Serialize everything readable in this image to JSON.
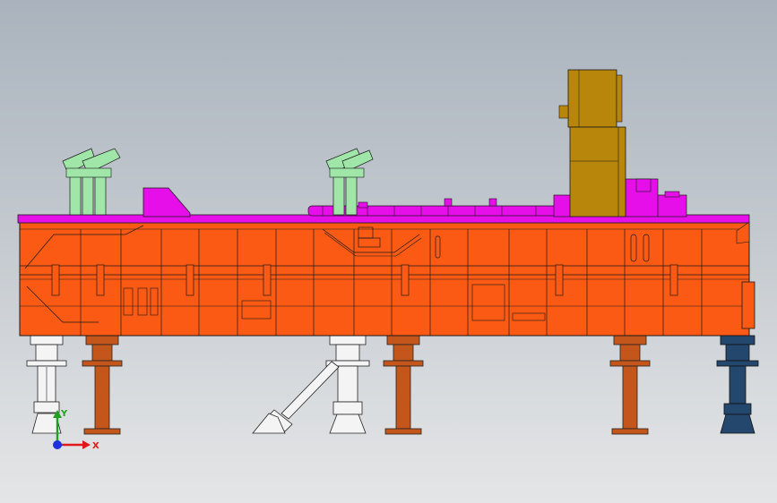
{
  "viewport": {
    "background_top": "#aab3bd",
    "background_bottom": "#e4e5e6"
  },
  "model": {
    "colors": {
      "base_frame": "#fb5a14",
      "top_plate": "#e70fe9",
      "actuator": "#b8860b",
      "vertical_clamps": "#9fe6a8",
      "support_copper": "#c4561c",
      "support_white": "#f4f4f4",
      "support_navy": "#24476e",
      "outline": "#1a1a1a"
    }
  },
  "triad": {
    "x_label": "X",
    "y_label": "Y",
    "x_color": "#e01818",
    "y_color": "#20a020",
    "z_color": "#2030e0"
  }
}
